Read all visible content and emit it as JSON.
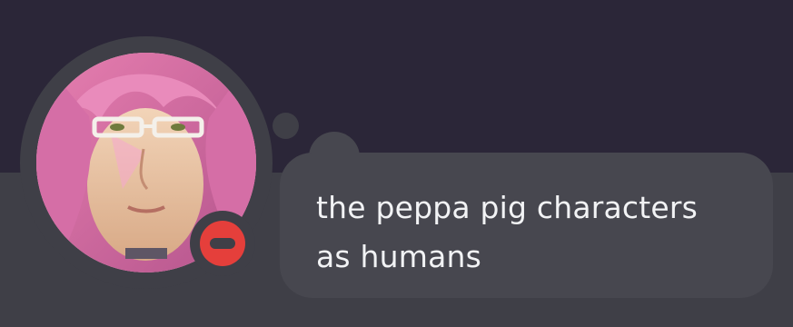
{
  "profile": {
    "avatar_icon": "user-avatar-pink-hair-glasses",
    "status": {
      "type": "do-not-disturb",
      "icon": "minus-circle-icon",
      "color": "#e53f3b"
    },
    "note": {
      "text": "the peppa pig characters as humans"
    }
  },
  "colors": {
    "banner": "#2b2638",
    "card": "#3f3f47",
    "bubble": "#47474f",
    "text": "#f2f3f5"
  }
}
